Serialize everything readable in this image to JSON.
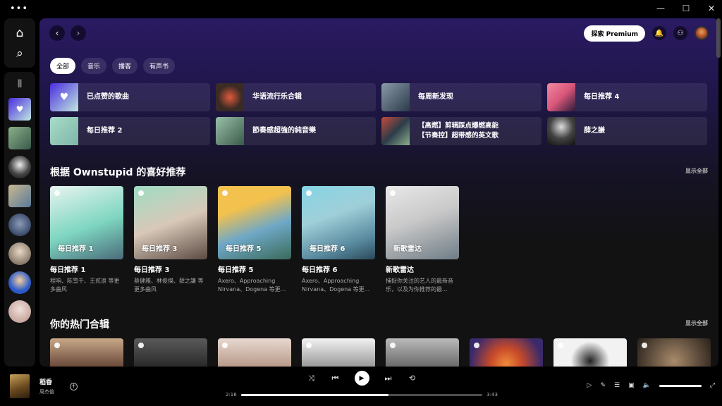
{
  "nav": {
    "home": "⌂",
    "search": "⌕",
    "library": "⫴"
  },
  "topbar": {
    "back": "‹",
    "forward": "›",
    "premium": "探索 Premium",
    "bell": "🔔",
    "friends": "⚇"
  },
  "chips": [
    {
      "label": "全部",
      "active": true
    },
    {
      "label": "音乐",
      "active": false
    },
    {
      "label": "播客",
      "active": false
    },
    {
      "label": "有声书",
      "active": false
    }
  ],
  "shortcuts": [
    {
      "label": "已点赞的歌曲",
      "color": "#6a4ee0"
    },
    {
      "label": "华语流行乐合辑",
      "color": "#3a2b25"
    },
    {
      "label": "每周新发现",
      "color": "#5d6e7a"
    },
    {
      "label": "每日推荐 4",
      "color": "#d9567a"
    },
    {
      "label": "每日推荐 2",
      "color": "#7fb6a8"
    },
    {
      "label": "節奏感超強的純音樂",
      "color": "#507a6a"
    },
    {
      "label": "【高燃】剪辑踩点爆燃高能\n【节奏控】超带感的英文歌",
      "color": "#2c3c4a"
    },
    {
      "label": "薛之謙",
      "color": "#2a2a2a"
    }
  ],
  "section1": {
    "title": "根据 Ownstupid 的喜好推荐",
    "show_all": "显示全部",
    "cards": [
      {
        "cover_label": "每日推荐 1",
        "title": "每日推荐 1",
        "subtitle": "程响、陈雪千、王贰浪 等更多曲风",
        "c1": "#7ed6c1",
        "c2": "#4a6b7a"
      },
      {
        "cover_label": "每日推荐 3",
        "title": "每日推荐 3",
        "subtitle": "蔡健雅、林俊傑、薛之謙 等更多曲风",
        "c1": "#9fdcc3",
        "c2": "#d8c8b8"
      },
      {
        "cover_label": "每日推荐 5",
        "title": "每日推荐 5",
        "subtitle": "Axero、Approaching Nirvana、Dogena 等更...",
        "c1": "#f2c14e",
        "c2": "#6fa8c7"
      },
      {
        "cover_label": "每日推荐 6",
        "title": "每日推荐 6",
        "subtitle": "Axero、Approaching Nirvana、Dogena 等更...",
        "c1": "#86d4e5",
        "c2": "#5b8ca1"
      },
      {
        "cover_label": "新歌雷达",
        "title": "新歌雷达",
        "subtitle": "捕捉你关注的艺人的最新音乐，以及为你推荐的最...",
        "c1": "#c9c9c9",
        "c2": "#6f7c86"
      }
    ]
  },
  "section2": {
    "title": "你的热门合辑",
    "show_all": "显示全部",
    "covers": [
      "#a07a5a",
      "#3a3a3a",
      "#d8c8c0",
      "#e8e8e8",
      "#9a9a9a",
      "#c84a2a",
      "#f2f2f2",
      "#5a4a3a"
    ]
  },
  "player": {
    "title": "稻香",
    "artist": "周杰倫",
    "elapsed": "2:16",
    "duration": "3:43",
    "progress": 0.61,
    "add": "+",
    "shuffle": "⤨",
    "prev": "⏮",
    "play": "▶",
    "next": "⏭",
    "repeat": "⟲"
  },
  "library_thumbs": [
    "#8c7ae6",
    "#7a9a6a",
    "#444",
    "#b0a080",
    "#6a7a9a",
    "#888",
    "#2a5ac8",
    "#d8c8c0"
  ]
}
